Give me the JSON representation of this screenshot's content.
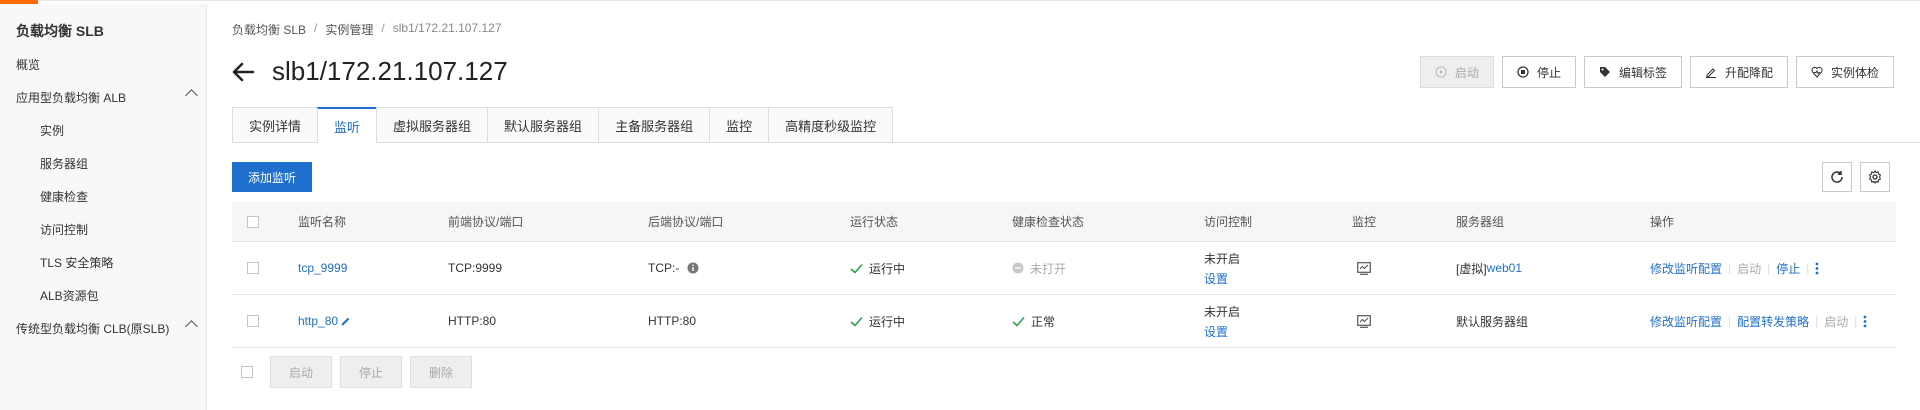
{
  "sidebar": {
    "title": "负载均衡 SLB",
    "items": [
      {
        "label": "概览"
      },
      {
        "label": "应用型负载均衡 ALB"
      },
      {
        "label": "实例"
      },
      {
        "label": "服务器组"
      },
      {
        "label": "健康检查"
      },
      {
        "label": "访问控制"
      },
      {
        "label": "TLS 安全策略"
      },
      {
        "label": "ALB资源包"
      },
      {
        "label": "传统型负载均衡 CLB(原SLB)"
      }
    ]
  },
  "breadcrumb": [
    "负载均衡 SLB",
    "实例管理",
    "slb1/172.21.107.127"
  ],
  "page_title": "slb1/172.21.107.127",
  "actions": {
    "start": "启动",
    "stop": "停止",
    "edit_tags": "编辑标签",
    "upgrade": "升配降配",
    "health": "实例体检"
  },
  "tabs": [
    "实例详情",
    "监听",
    "虚拟服务器组",
    "默认服务器组",
    "主备服务器组",
    "监控",
    "高精度秒级监控"
  ],
  "toolbar": {
    "add_listener": "添加监听"
  },
  "table": {
    "headers": [
      "监听名称",
      "前端协议/端口",
      "后端协议/端口",
      "运行状态",
      "健康检查状态",
      "访问控制",
      "监控",
      "服务器组",
      "操作"
    ],
    "rows": [
      {
        "name": "tcp_9999",
        "frontend": "TCP:9999",
        "backend": "TCP:-",
        "status": "运行中",
        "health": "未打开",
        "acl": "未开启",
        "acl_link": "设置",
        "group_prefix": "[虚拟]",
        "group": "web01",
        "op1": "修改监听配置",
        "op2": "启动",
        "op3": "停止"
      },
      {
        "name": "http_80",
        "frontend": "HTTP:80",
        "backend": "HTTP:80",
        "status": "运行中",
        "health": "正常",
        "acl": "未开启",
        "acl_link": "设置",
        "group": "默认服务器组",
        "op1": "修改监听配置",
        "op2": "配置转发策略",
        "op3": "启动"
      }
    ]
  },
  "footer": {
    "start": "启动",
    "stop": "停止",
    "delete": "删除"
  },
  "colors": {
    "primary": "#1f6fce",
    "accent": "#ff6a00",
    "success": "#2ea44f"
  }
}
